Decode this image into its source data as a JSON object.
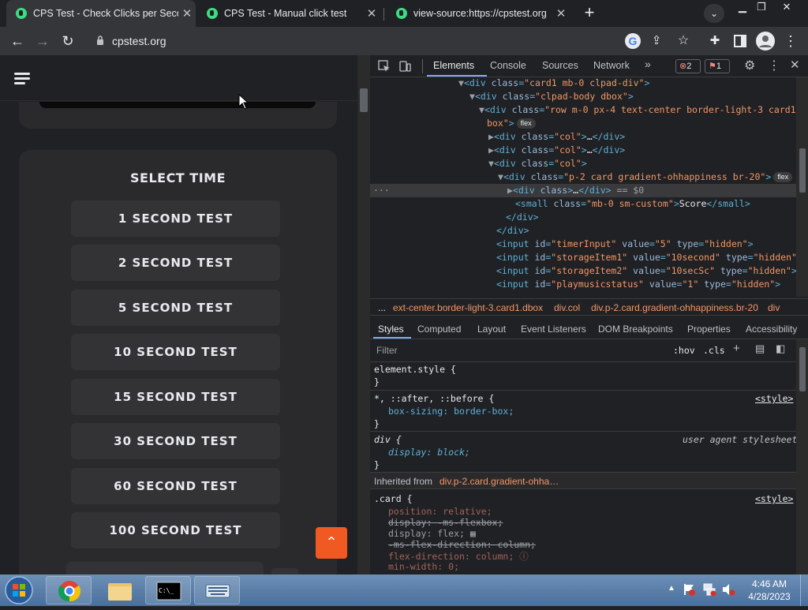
{
  "browser": {
    "tabs": [
      {
        "title": "CPS Test - Check Clicks per Second",
        "active": true
      },
      {
        "title": "CPS Test - Manual click test",
        "active": false
      },
      {
        "title": "view-source:https://cpstest.org",
        "active": false
      }
    ],
    "url": "cpstest.org"
  },
  "page": {
    "select_time_heading": "SELECT TIME",
    "time_options": [
      "1 SECOND TEST",
      "2 SECOND TEST",
      "5 SECOND TEST",
      "10 SECOND TEST",
      "15 SECOND TEST",
      "30 SECOND TEST",
      "60 SECOND TEST",
      "100 SECOND TEST"
    ],
    "scroll_top_icon": "double-chevron-up-icon"
  },
  "devtools": {
    "tabs": [
      "Elements",
      "Console",
      "Sources",
      "Network"
    ],
    "more": "»",
    "error_count": "2",
    "issue_count": "1",
    "selected_marker": "== $0",
    "flex_badge": "flex",
    "breadcrumb": [
      "...",
      "ext-center.border-light-3.card1.dbox",
      "div.col",
      "div.p-2.card.gradient-ohhappiness.br-20",
      "div"
    ],
    "styles_tabs": [
      "Styles",
      "Computed",
      "Layout",
      "Event Listeners",
      "DOM Breakpoints",
      "Properties",
      "Accessibility"
    ],
    "filter_placeholder": "Filter",
    "hov": ":hov",
    "cls": ".cls",
    "rules": [
      {
        "selector": "element.style {",
        "close": "}"
      },
      {
        "selector": "*, ::after, ::before {",
        "source": "<style>",
        "decl": "box-sizing: border-box;",
        "close": "}"
      },
      {
        "selector": "div {",
        "source": "user agent stylesheet",
        "decl": "display: block;",
        "close": "}"
      }
    ],
    "inherited_label": "Inherited from",
    "inherited_from": "div.p-2.card.gradient-ohha…",
    "card_rule": {
      "selector": ".card {",
      "source": "<style>",
      "decls": [
        "position: relative;",
        "display: -ms-flexbox;",
        "display: flex;",
        "-ms-flex-direction: column;",
        "flex-direction: column;",
        "min-width: 0;"
      ]
    }
  },
  "taskbar": {
    "time": "4:46 AM",
    "date": "4/28/2023"
  }
}
